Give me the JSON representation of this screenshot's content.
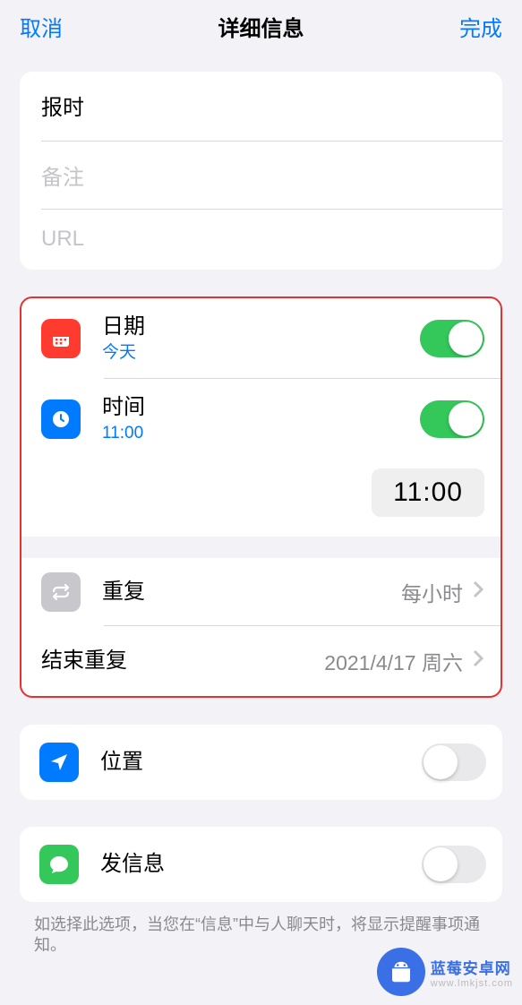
{
  "header": {
    "cancel": "取消",
    "title": "详细信息",
    "done": "完成"
  },
  "fields": {
    "title_value": "报时",
    "notes_placeholder": "备注",
    "url_placeholder": "URL"
  },
  "date": {
    "label": "日期",
    "sub": "今天",
    "on": true
  },
  "time": {
    "label": "时间",
    "sub": "11:00",
    "on": true,
    "picker": "11:00"
  },
  "repeat": {
    "label": "重复",
    "value": "每小时"
  },
  "end_repeat": {
    "label": "结束重复",
    "value": "2021/4/17 周六"
  },
  "location": {
    "label": "位置",
    "on": false
  },
  "messaging": {
    "label": "发信息",
    "on": false,
    "note": "如选择此选项，当您在“信息”中与人聊天时，将显示提醒事项通知。"
  },
  "watermark": {
    "name": "蓝莓安卓网",
    "url": "www.lmkjst.com"
  }
}
